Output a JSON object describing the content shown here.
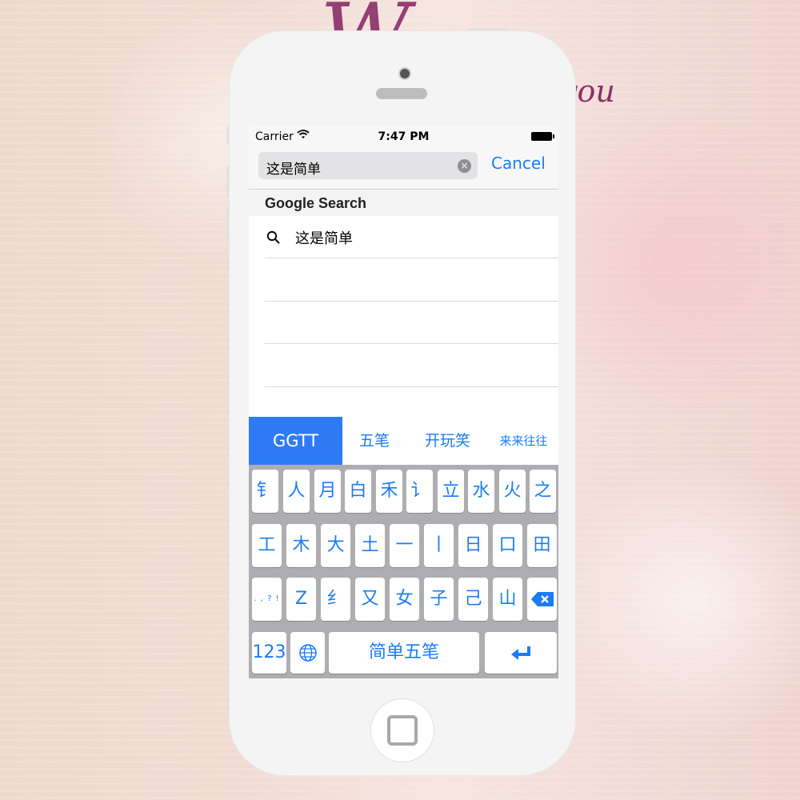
{
  "status_bar": {
    "carrier": "Carrier",
    "time": "7:47 PM"
  },
  "search": {
    "query": "这是简单",
    "cancel_label": "Cancel"
  },
  "results": {
    "section_title": "Google Search",
    "items": [
      "这是简单"
    ]
  },
  "candidates": [
    {
      "label": "GGTT",
      "active": true
    },
    {
      "label": "五笔",
      "active": false
    },
    {
      "label": "开玩笑",
      "active": false
    },
    {
      "label": "来来往往",
      "active": false
    }
  ],
  "keyboard": {
    "row1": [
      "钅",
      "人",
      "月",
      "白",
      "禾",
      "讠",
      "立",
      "水",
      "火",
      "之"
    ],
    "row2": [
      "工",
      "木",
      "大",
      "土",
      "一",
      "丨",
      "日",
      "口",
      "田"
    ],
    "row3_symbols": ". , ? !",
    "row3": [
      "Z",
      "纟",
      "又",
      "女",
      "子",
      "己",
      "山"
    ],
    "numbers_label": "123",
    "space_label": "简单五笔"
  },
  "colors": {
    "accent": "#1a7cf5",
    "active_candidate": "#2f7bf6",
    "keyboard_bg": "#aeaeb2"
  },
  "icons": {
    "wifi": "wifi-icon",
    "battery": "battery-icon",
    "clear": "clear-icon",
    "search": "search-icon",
    "globe": "globe-icon",
    "backspace": "backspace-icon",
    "return": "return-icon"
  }
}
